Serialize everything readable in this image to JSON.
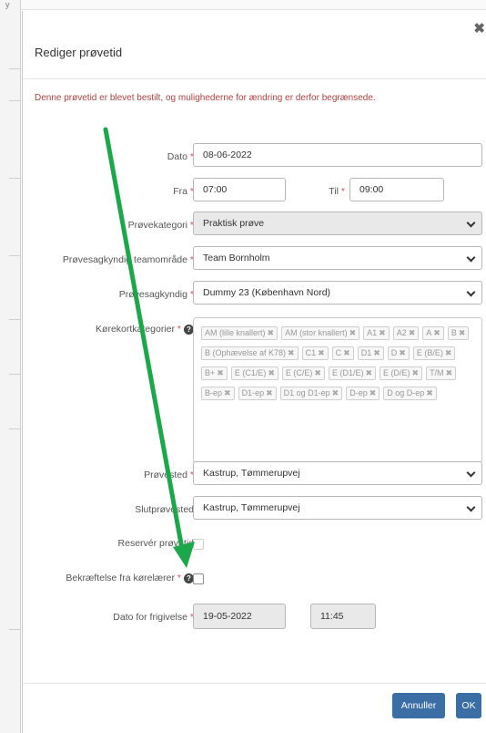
{
  "background": {
    "glyph": "y"
  },
  "dialog": {
    "title": "Rediger prøvetid",
    "warning": "Denne prøvetid er blevet bestilt, og mulighederne for ændring er derfor begrænsede.",
    "close_icon": "close-icon"
  },
  "form": {
    "dato": {
      "label": "Dato",
      "value": "08-06-2022"
    },
    "fra": {
      "label": "Fra",
      "value": "07:00"
    },
    "til": {
      "label": "Til",
      "value": "09:00"
    },
    "provekategori": {
      "label": "Prøvekategori",
      "value": "Praktisk prøve"
    },
    "teamomraade": {
      "label": "Prøvesagkyndig teamområde",
      "value": "Team Bornholm"
    },
    "provesagkyndig": {
      "label": "Prøvesagkyndig",
      "value": "Dummy 23 (København Nord)"
    },
    "korekort": {
      "label": "Kørekortkategorier",
      "tags": [
        "AM (lille knallert)",
        "AM (stor knallert)",
        "A1",
        "A2",
        "A",
        "B",
        "B (Ophævelse af K78)",
        "C1",
        "C",
        "D1",
        "D",
        "E (B/E)",
        "B+",
        "E (C1/E)",
        "E (C/E)",
        "E (D1/E)",
        "E (D/E)",
        "T/M",
        "B-ep",
        "D1-ep",
        "D1 og D1-ep",
        "D-ep",
        "D og D-ep"
      ]
    },
    "provested": {
      "label": "Prøvested",
      "value": "Kastrup, Tømmerupvej"
    },
    "slutprovested": {
      "label": "Slutprøvested",
      "value": "Kastrup, Tømmerupvej"
    },
    "reserver": {
      "label": "Reservér prøvetid"
    },
    "bekraeftelse": {
      "label": "Bekræftelse fra kørelærer"
    },
    "frigivelse": {
      "label": "Dato for frigivelse",
      "date": "19-05-2022",
      "time": "11:45"
    },
    "required_mark": "*"
  },
  "footer": {
    "cancel": "Annuller",
    "ok": "OK"
  },
  "colors": {
    "annotation_arrow": "#1ca84a",
    "primary_button": "#3a6ea5",
    "required": "#d9534f",
    "warning": "#a94442"
  }
}
